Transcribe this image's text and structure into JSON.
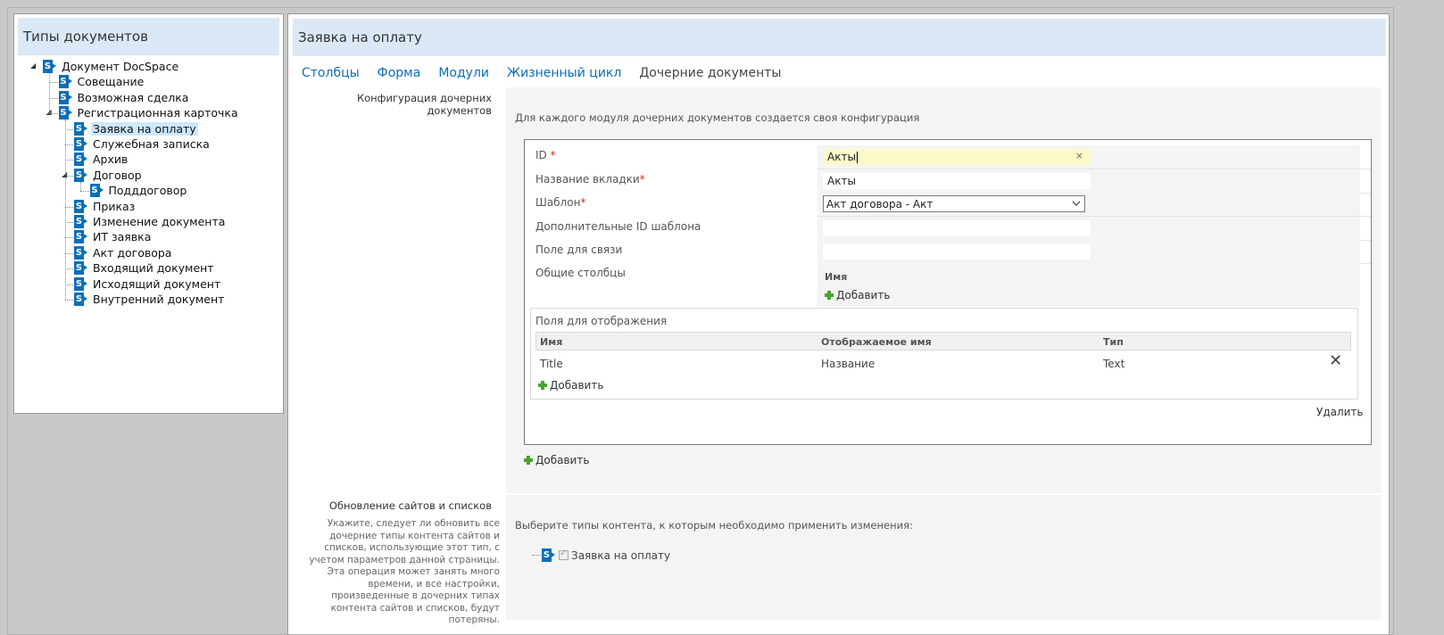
{
  "left": {
    "title": "Типы документов",
    "tree": [
      {
        "label": "Документ DocSpace",
        "depth": 0,
        "expanded": true
      },
      {
        "label": "Совещание",
        "depth": 1
      },
      {
        "label": "Возможная сделка",
        "depth": 1
      },
      {
        "label": "Регистрационная карточка",
        "depth": 1,
        "expanded": true
      },
      {
        "label": "Заявка на оплату",
        "depth": 2,
        "selected": true
      },
      {
        "label": "Служебная записка",
        "depth": 2
      },
      {
        "label": "Архив",
        "depth": 2
      },
      {
        "label": "Договор",
        "depth": 2,
        "expanded": true
      },
      {
        "label": "Подддоговор",
        "depth": 3
      },
      {
        "label": "Приказ",
        "depth": 2
      },
      {
        "label": "Изменение документа",
        "depth": 2
      },
      {
        "label": "ИТ заявка",
        "depth": 2
      },
      {
        "label": "Акт договора",
        "depth": 2
      },
      {
        "label": "Входящий документ",
        "depth": 2
      },
      {
        "label": "Исходящий документ",
        "depth": 2
      },
      {
        "label": "Внутренний документ",
        "depth": 2
      }
    ]
  },
  "right": {
    "title": "Заявка на оплату",
    "tabs": [
      {
        "label": "Столбцы",
        "active": false
      },
      {
        "label": "Форма",
        "active": false
      },
      {
        "label": "Модули",
        "active": false
      },
      {
        "label": "Жизненный цикл",
        "active": false
      },
      {
        "label": "Дочерние документы",
        "active": true
      }
    ],
    "section1": {
      "label": "Конфигурация дочерних документов",
      "description": "Для каждого модуля дочерних документов создается своя конфигурация"
    },
    "form": {
      "id_label": "ID",
      "id_value": "Акты",
      "tab_name_label": "Название вкладки",
      "tab_name_value": "Акты",
      "template_label": "Шаблон",
      "template_value": "Акт договора - Акт",
      "extra_template_label": "Дополнительные ID шаблона",
      "extra_template_value": "",
      "link_field_label": "Поле для связи",
      "link_field_value": "",
      "common_columns_label": "Общие столбцы",
      "common_columns_header": "Имя",
      "add_label": "Добавить",
      "required_mark": "*",
      "clear_glyph": "×"
    },
    "display_fields": {
      "title": "Поля для отображения",
      "columns": [
        "Имя",
        "Отображаемое имя",
        "Тип"
      ],
      "rows": [
        {
          "name": "Title",
          "display_name": "Название",
          "type": "Text"
        }
      ],
      "add_label": "Добавить",
      "delete_glyph": "✕"
    },
    "delete_label": "Удалить",
    "add_config_label": "Добавить",
    "section2": {
      "label": "Обновление сайтов и списков",
      "help": "Укажите, следует ли обновить все дочерние типы контента сайтов и списков, использующие этот тип, с учетом параметров данной страницы. Эта операция может занять много времени, и все настройки, произведенные в дочерних типах контента сайтов и списков, будут потеряны.",
      "description": "Выберите типы контента, к которым необходимо применить изменения:",
      "content_type_label": "Заявка на оплату",
      "content_type_checked": true
    }
  },
  "colors": {
    "header_bg": "#dbe8f6",
    "link": "#0b6fb7",
    "sp_icon": "#0b6fb7",
    "add_green": "#4ca22e",
    "highlight_input": "#fbf9c8",
    "selected_node": "#cce8ff"
  }
}
